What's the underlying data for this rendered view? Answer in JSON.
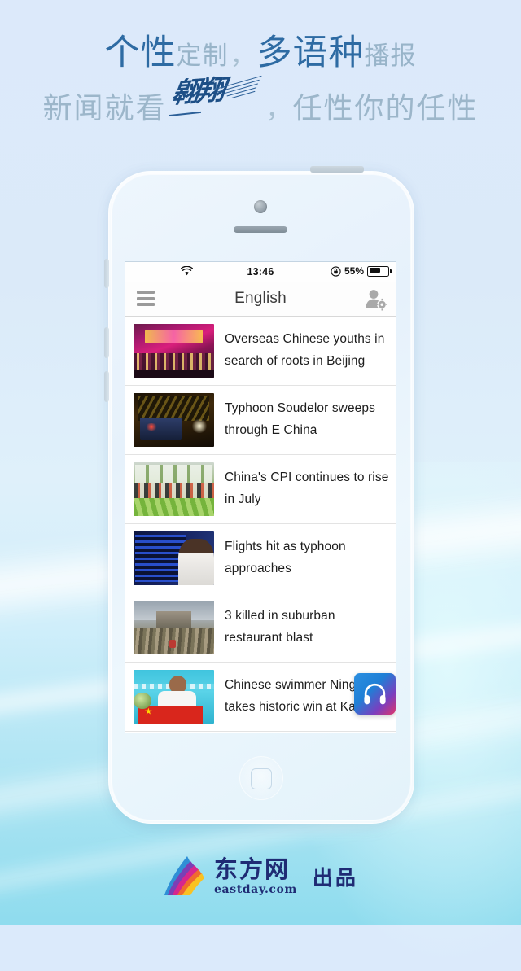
{
  "promo": {
    "line1": [
      {
        "text": "个性",
        "style": "strong"
      },
      {
        "text": "定制",
        "style": "light"
      },
      {
        "text": "，",
        "style": "comma"
      },
      {
        "text": "多语种",
        "style": "strong"
      },
      {
        "text": "播报",
        "style": "light"
      }
    ],
    "line2_prefix": "新闻就看",
    "brand_mark": "翱翔",
    "line2_comma": "，",
    "line2_suffix": "任性你的任性",
    "strong_color": "#2e6ba3",
    "light_color": "#98b4c9",
    "brand_color": "#1d4f86"
  },
  "phone": {
    "status_bar": {
      "wifi_icon": "wifi-icon",
      "time": "13:46",
      "rotation_lock_icon": "rotation-lock-icon",
      "battery_percent": "55%",
      "battery_icon": "battery-icon"
    },
    "nav_bar": {
      "menu_icon": "hamburger-menu-icon",
      "title": "English",
      "profile_icon": "profile-settings-icon"
    },
    "news": [
      {
        "title": "Overseas Chinese youths in search of roots in Beijing",
        "thumb": "stage-event-photo",
        "thumb_class": "th-stage"
      },
      {
        "title": "Typhoon Soudelor sweeps through E China",
        "thumb": "typhoon-night-rescue-photo",
        "thumb_class": "th-typhoon"
      },
      {
        "title": "China's CPI continues to rise in July",
        "thumb": "vegetable-market-photo",
        "thumb_class": "th-market"
      },
      {
        "title": "Flights hit as typhoon approaches",
        "thumb": "airport-flight-board-photo",
        "thumb_class": "th-flights"
      },
      {
        "title": "3 killed in suburban restaurant blast",
        "thumb": "blast-rubble-photo",
        "thumb_class": "th-blast"
      },
      {
        "title": "Chinese swimmer Ning takes historic win at Ka",
        "thumb": "swimmer-medal-photo",
        "thumb_class": "th-swim"
      }
    ],
    "audio_button": {
      "icon": "headphones-icon",
      "accent_start": "#2b8fe0",
      "accent_end": "#e0356b"
    }
  },
  "footer": {
    "logo_cn": "东方网",
    "logo_en": "eastday.com",
    "suffix": "出品",
    "logo_color": "#1f2b74"
  }
}
